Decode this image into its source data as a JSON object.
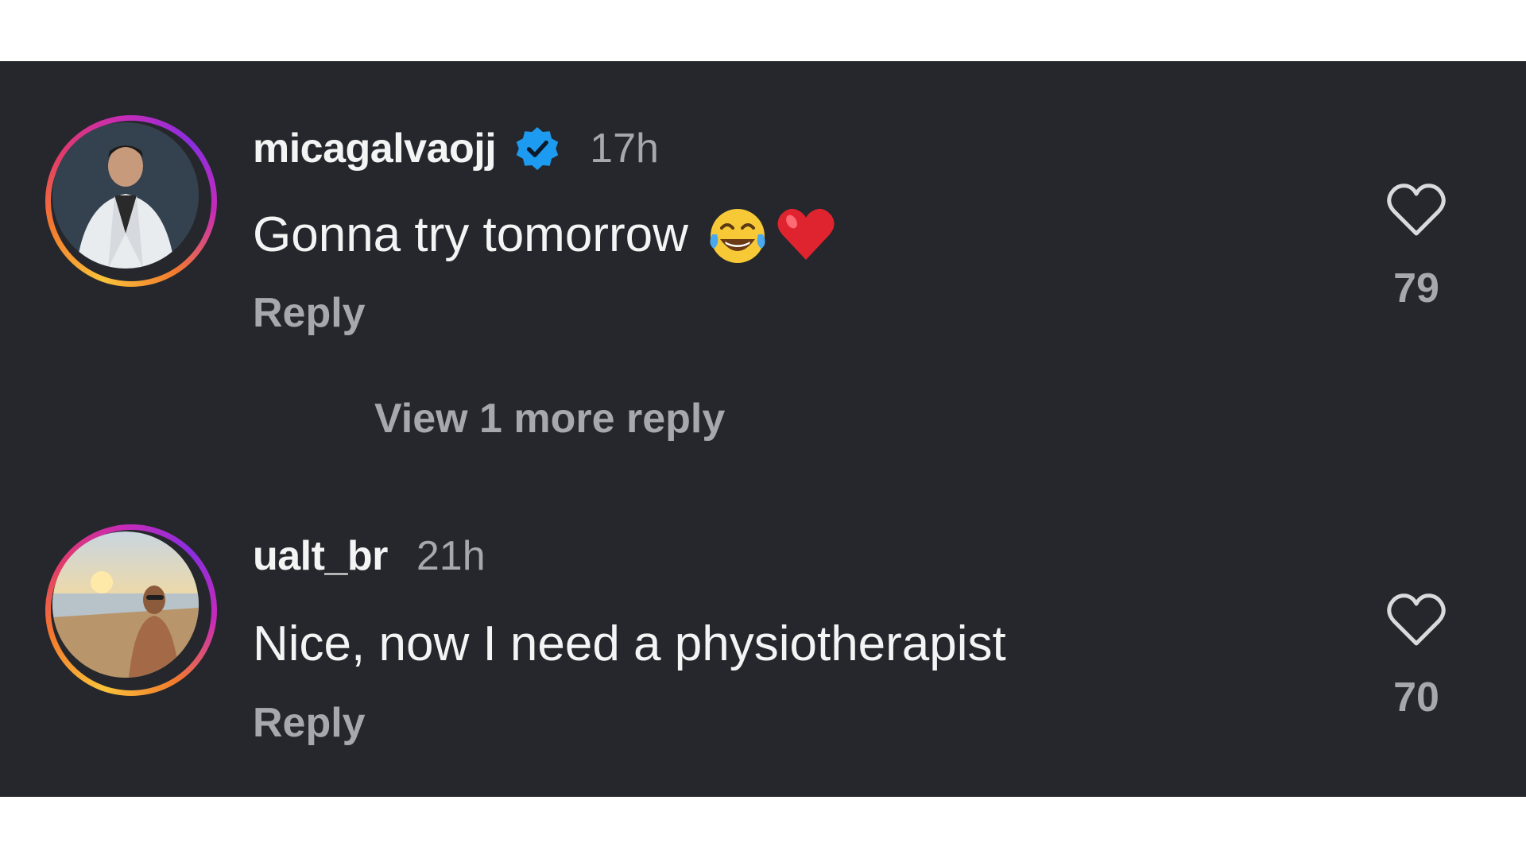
{
  "comments": [
    {
      "username": "micagalvaojj",
      "verified": true,
      "time": "17h",
      "text": "Gonna try tomorrow",
      "emojis": [
        "face-with-tears-of-joy",
        "red-heart"
      ],
      "reply_label": "Reply",
      "likes": "79"
    },
    {
      "username": "ualt_br",
      "verified": false,
      "time": "21h",
      "text": "Nice, now I need a physiotherapist",
      "reply_label": "Reply",
      "likes": "70"
    }
  ],
  "view_more_label": "View 1 more reply",
  "colors": {
    "background": "#25272c",
    "primary_text": "#f4f4f5",
    "secondary_text": "#a6a8ad",
    "verified_blue": "#1d9bf0"
  }
}
